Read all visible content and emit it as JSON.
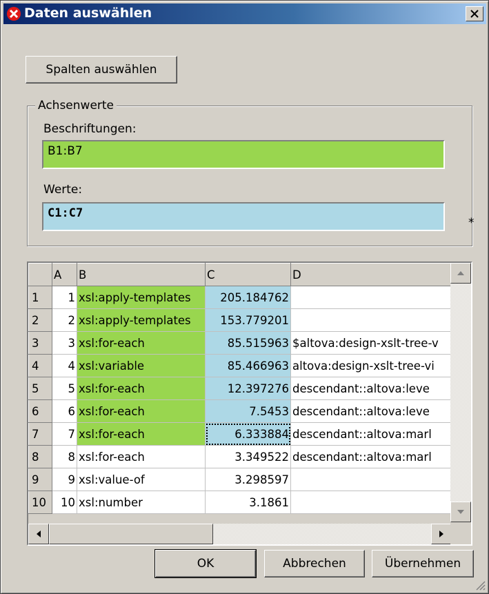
{
  "window": {
    "title": "Daten auswählen"
  },
  "buttons": {
    "select_columns": "Spalten auswählen",
    "ok": "OK",
    "cancel": "Abbrechen",
    "apply": "Übernehmen"
  },
  "axis_group": {
    "legend": "Achsenwerte",
    "labels_label": "Beschriftungen:",
    "labels_value": "B1:B7",
    "values_label": "Werte:",
    "values_value": "C1:C7",
    "asterisk": "*"
  },
  "grid": {
    "columns": [
      "",
      "A",
      "B",
      "C",
      "D"
    ],
    "rows": [
      {
        "n": "1",
        "a": "1",
        "b": "xsl:apply-templates",
        "c": "205.184762",
        "d": ""
      },
      {
        "n": "2",
        "a": "2",
        "b": "xsl:apply-templates",
        "c": "153.779201",
        "d": ""
      },
      {
        "n": "3",
        "a": "3",
        "b": "xsl:for-each",
        "c": "85.515963",
        "d": "$altova:design-xslt-tree-v"
      },
      {
        "n": "4",
        "a": "4",
        "b": "xsl:variable",
        "c": "85.466963",
        "d": "altova:design-xslt-tree-vi"
      },
      {
        "n": "5",
        "a": "5",
        "b": "xsl:for-each",
        "c": "12.397276",
        "d": "descendant::altova:leve"
      },
      {
        "n": "6",
        "a": "6",
        "b": "xsl:for-each",
        "c": "7.5453",
        "d": "descendant::altova:leve"
      },
      {
        "n": "7",
        "a": "7",
        "b": "xsl:for-each",
        "c": "6.333884",
        "d": "descendant::altova:marl"
      },
      {
        "n": "8",
        "a": "8",
        "b": "xsl:for-each",
        "c": "3.349522",
        "d": "descendant::altova:marl"
      },
      {
        "n": "9",
        "a": "9",
        "b": "xsl:value-of",
        "c": "3.298597",
        "d": ""
      },
      {
        "n": "10",
        "a": "10",
        "b": "xsl:number",
        "c": "3.1861",
        "d": ""
      }
    ],
    "highlight_rows": 7,
    "selected_row": 7
  },
  "icons": {
    "app": "altova-app-icon",
    "close": "close-icon",
    "scroll_up": "arrow-up-icon",
    "scroll_down": "arrow-down-icon",
    "scroll_left": "arrow-left-icon",
    "scroll_right": "arrow-right-icon",
    "grip": "resize-grip-icon"
  },
  "colors": {
    "label_range": "#99d64f",
    "value_range": "#add8e6",
    "titlebar": "#0a246a"
  }
}
